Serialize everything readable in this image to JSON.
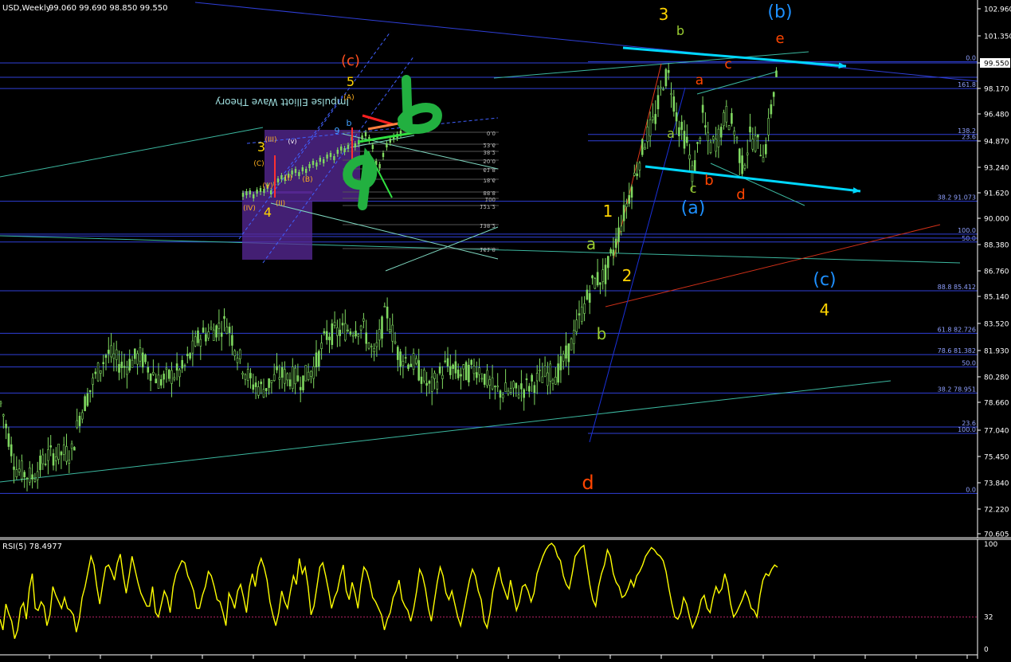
{
  "header": {
    "symbol_timeframe": "USD,Weekly",
    "ohlc": "99.060 99.690 98.850 99.550"
  },
  "price_axis": {
    "ticks": [
      "102.960",
      "101.350",
      "99.550",
      "98.170",
      "96.480",
      "94.870",
      "93.240",
      "91.620",
      "90.000",
      "88.380",
      "86.760",
      "85.140",
      "83.520",
      "81.930",
      "80.280",
      "78.660",
      "77.040",
      "75.450",
      "73.840",
      "72.220",
      "70.605"
    ],
    "current_price": "99.550"
  },
  "rsi": {
    "title": "RSI(5) 78.4977",
    "axis_labels": [
      "100",
      "32",
      "0"
    ],
    "level": 32,
    "last_value": 78.4977,
    "values": [
      30,
      20,
      44,
      35,
      28,
      12,
      20,
      40,
      45,
      30,
      58,
      72,
      40,
      38,
      46,
      42,
      24,
      34,
      60,
      52,
      46,
      40,
      50,
      40,
      38,
      34,
      18,
      30,
      50,
      60,
      74,
      88,
      80,
      60,
      44,
      62,
      78,
      80,
      74,
      66,
      82,
      90,
      70,
      54,
      70,
      88,
      76,
      64,
      54,
      48,
      42,
      42,
      60,
      36,
      32,
      44,
      56,
      50,
      36,
      60,
      72,
      78,
      84,
      82,
      70,
      64,
      56,
      40,
      40,
      52,
      60,
      74,
      70,
      60,
      48,
      46,
      36,
      24,
      54,
      48,
      40,
      56,
      62,
      50,
      36,
      60,
      72,
      60,
      78,
      86,
      78,
      66,
      46,
      34,
      24,
      36,
      56,
      46,
      40,
      56,
      70,
      62,
      86,
      72,
      78,
      60,
      34,
      42,
      60,
      78,
      82,
      70,
      56,
      40,
      50,
      56,
      70,
      80,
      56,
      48,
      64,
      54,
      40,
      62,
      78,
      74,
      64,
      50,
      46,
      40,
      34,
      20,
      30,
      36,
      50,
      56,
      66,
      48,
      42,
      38,
      28,
      40,
      56,
      76,
      70,
      58,
      40,
      28,
      46,
      64,
      78,
      70,
      54,
      48,
      56,
      44,
      32,
      24,
      38,
      52,
      66,
      76,
      70,
      56,
      48,
      28,
      22,
      36,
      56,
      68,
      78,
      64,
      56,
      48,
      66,
      52,
      38,
      46,
      60,
      62,
      56,
      46,
      54,
      72,
      80,
      88,
      94,
      98,
      100,
      97,
      88,
      84,
      70,
      62,
      58,
      72,
      88,
      92,
      96,
      98,
      80,
      62,
      48,
      42,
      60,
      72,
      80,
      94,
      88,
      72,
      64,
      60,
      50,
      52,
      58,
      66,
      60,
      70,
      74,
      80,
      88,
      92,
      96,
      94,
      90,
      88,
      84,
      74,
      58,
      44,
      32,
      30,
      36,
      50,
      44,
      32,
      22,
      28,
      36,
      48,
      52,
      40,
      36,
      50,
      60,
      54,
      58,
      72,
      62,
      44,
      32,
      36,
      42,
      48,
      56,
      50,
      40,
      38,
      32,
      52,
      66,
      72,
      70,
      76,
      80,
      78
    ]
  },
  "chart_data": {
    "type": "candlestick",
    "title": "USD,Weekly",
    "ylim": [
      69.8,
      103.8
    ],
    "period": "Weekly",
    "last_close": 99.55,
    "levels": [
      {
        "label": "0.0",
        "value": 99.9
      },
      {
        "label": "161.8",
        "value": 98.2
      },
      {
        "label": "138.2",
        "value": 95.3
      },
      {
        "label": "23.6",
        "value": 94.9
      },
      {
        "label": "38.2 91.073",
        "value": 91.073
      },
      {
        "label": "100.0",
        "value": 89.0
      },
      {
        "label": "50.0",
        "value": 88.5
      },
      {
        "label": "88.8 85.412",
        "value": 85.412
      },
      {
        "label": "61.8 82.726",
        "value": 82.726
      },
      {
        "label": "78.6 81.382",
        "value": 81.382
      },
      {
        "label": "50.0",
        "value": 80.6
      },
      {
        "label": "38.2 78.951",
        "value": 78.951
      },
      {
        "label": "23.6",
        "value": 76.8
      },
      {
        "label": "100.0",
        "value": 76.4
      },
      {
        "label": "0.0",
        "value": 72.6
      }
    ],
    "wave_labels": [
      {
        "text": "3",
        "color": "#ffd400"
      },
      {
        "text": "b",
        "color": "#9acd32"
      },
      {
        "text": "(b)",
        "color": "#1e90ff"
      },
      {
        "text": "e",
        "color": "#ff4500"
      },
      {
        "text": "c",
        "color": "#ff4500"
      },
      {
        "text": "a",
        "color": "#ff4500"
      },
      {
        "text": "a",
        "color": "#9acd32"
      },
      {
        "text": "c",
        "color": "#9acd32"
      },
      {
        "text": "b",
        "color": "#ff4500"
      },
      {
        "text": "d",
        "color": "#ff4500"
      },
      {
        "text": "(a)",
        "color": "#1e90ff"
      },
      {
        "text": "1",
        "color": "#ffd400"
      },
      {
        "text": "a",
        "color": "#9acd32"
      },
      {
        "text": "2",
        "color": "#ffd400"
      },
      {
        "text": "b",
        "color": "#9acd32"
      },
      {
        "text": "(c)",
        "color": "#1e90ff"
      },
      {
        "text": "4",
        "color": "#ffd400"
      },
      {
        "text": "d",
        "color": "#ff4500"
      }
    ],
    "inset": {
      "labels": [
        "(c)",
        "5",
        "b",
        "9",
        "3",
        "4",
        "(A)",
        "(B)",
        "(C)",
        "(I)",
        "(II)",
        "(III)",
        "(IV)",
        "(V)",
        "(v)"
      ],
      "mirrored_caption": "Impulse Elliott Wave Theory",
      "fib_labels": [
        "0.0",
        "23.6",
        "38.2",
        "50.0",
        "61.8",
        "78.6",
        "88.8",
        "100",
        "127.2",
        "138.2",
        "161.8"
      ]
    },
    "grid": false,
    "colors": {
      "candle": "#7fd860",
      "level_line": "#2f3fd8",
      "trend_line": "#24a28c",
      "arrow": "#00d8ff",
      "rsi": "#ffff00",
      "background": "#000000"
    }
  }
}
